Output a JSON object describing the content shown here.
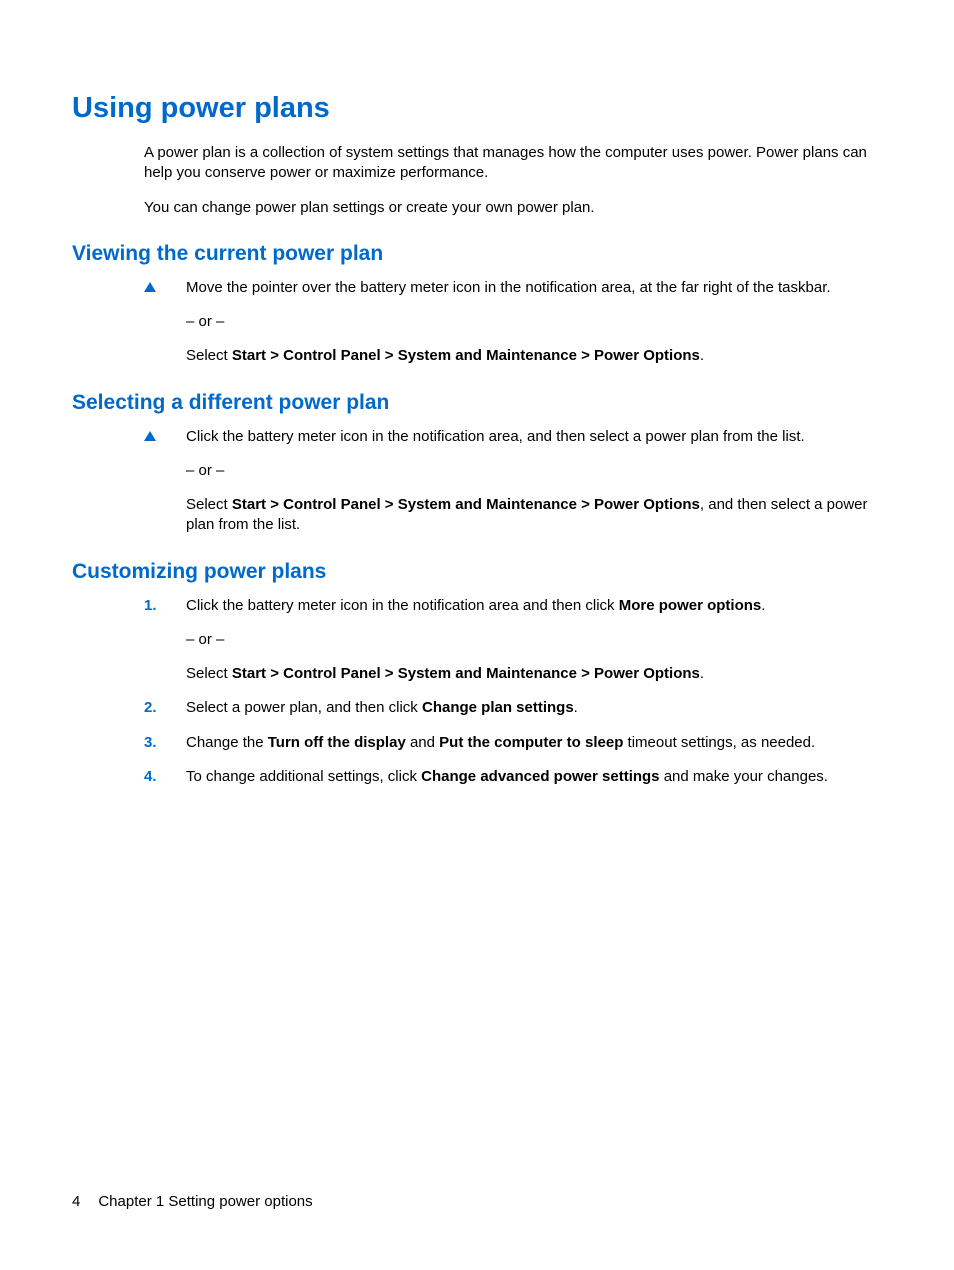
{
  "title": "Using power plans",
  "intro": {
    "p1": "A power plan is a collection of system settings that manages how the computer uses power. Power plans can help you conserve power or maximize performance.",
    "p2": "You can change power plan settings or create your own power plan."
  },
  "viewing": {
    "heading": "Viewing the current power plan",
    "step_text": "Move the pointer over the battery meter icon in the notification area, at the far right of the taskbar.",
    "or": "– or –",
    "select_prefix": "Select ",
    "select_bold": "Start > Control Panel > System and Maintenance > Power Options",
    "select_suffix": "."
  },
  "selecting": {
    "heading": "Selecting a different power plan",
    "step_text": "Click the battery meter icon in the notification area, and then select a power plan from the list.",
    "or": "– or –",
    "select_prefix": "Select ",
    "select_bold": "Start > Control Panel > System and Maintenance > Power Options",
    "select_suffix": ", and then select a power plan from the list."
  },
  "customizing": {
    "heading": "Customizing power plans",
    "step1_prefix": "Click the battery meter icon in the notification area and then click ",
    "step1_bold": "More power options",
    "step1_suffix": ".",
    "step1_or": "– or –",
    "step1_select_prefix": "Select ",
    "step1_select_bold": "Start > Control Panel > System and Maintenance > Power Options",
    "step1_select_suffix": ".",
    "step2_prefix": "Select a power plan, and then click ",
    "step2_bold": "Change plan settings",
    "step2_suffix": ".",
    "step3_prefix": "Change the ",
    "step3_bold1": "Turn off the display",
    "step3_mid": " and ",
    "step3_bold2": "Put the computer to sleep",
    "step3_suffix": " timeout settings, as needed.",
    "step4_prefix": "To change additional settings, click ",
    "step4_bold": "Change advanced power settings",
    "step4_suffix": " and make your changes.",
    "num1": "1.",
    "num2": "2.",
    "num3": "3.",
    "num4": "4."
  },
  "footer": {
    "page": "4",
    "chapter": "Chapter 1   Setting power options"
  }
}
